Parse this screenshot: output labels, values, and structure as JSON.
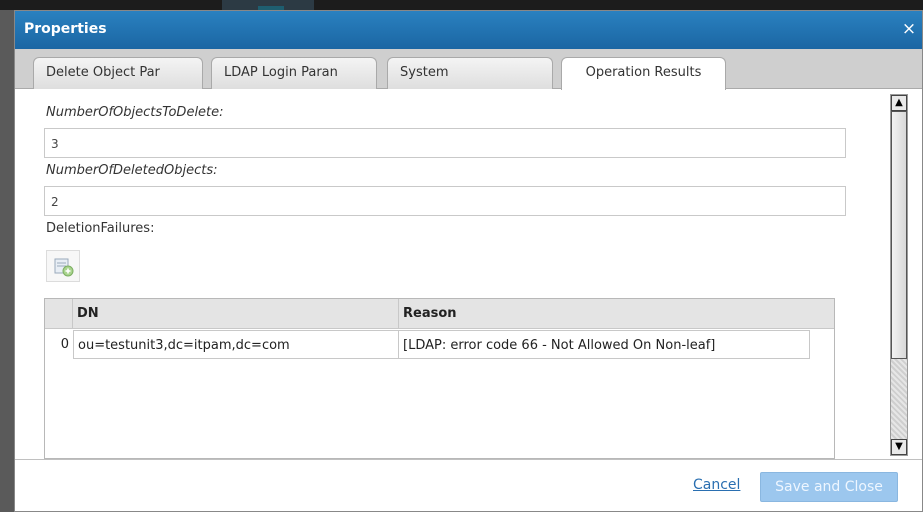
{
  "dialog": {
    "title": "Properties",
    "close_glyph": "×"
  },
  "tabs": [
    {
      "label": "Delete Object Par"
    },
    {
      "label": "LDAP Login Paran"
    },
    {
      "label": "System"
    },
    {
      "label": "Operation Results",
      "active": true
    }
  ],
  "fields": {
    "objects_to_delete": {
      "label": "NumberOfObjectsToDelete:",
      "value": "3"
    },
    "deleted_objects": {
      "label": "NumberOfDeletedObjects:",
      "value": "2"
    },
    "deletion_failures": {
      "label": "DeletionFailures:"
    }
  },
  "add_row_icon": "add-row-icon",
  "grid": {
    "columns": [
      "DN",
      "Reason"
    ],
    "rows": [
      {
        "index": "0",
        "dn": "ou=testunit3,dc=itpam,dc=com",
        "reason": "[LDAP: error code 66 - Not Allowed On Non-leaf]"
      }
    ]
  },
  "scrollbar": {
    "up_glyph": "▲",
    "down_glyph": "▼"
  },
  "footer": {
    "cancel_label": "Cancel",
    "save_label": "Save and Close"
  },
  "colors": {
    "titlebar": "#1f6fae",
    "save_button": "#9cc7ee",
    "link": "#2a6fb1"
  }
}
